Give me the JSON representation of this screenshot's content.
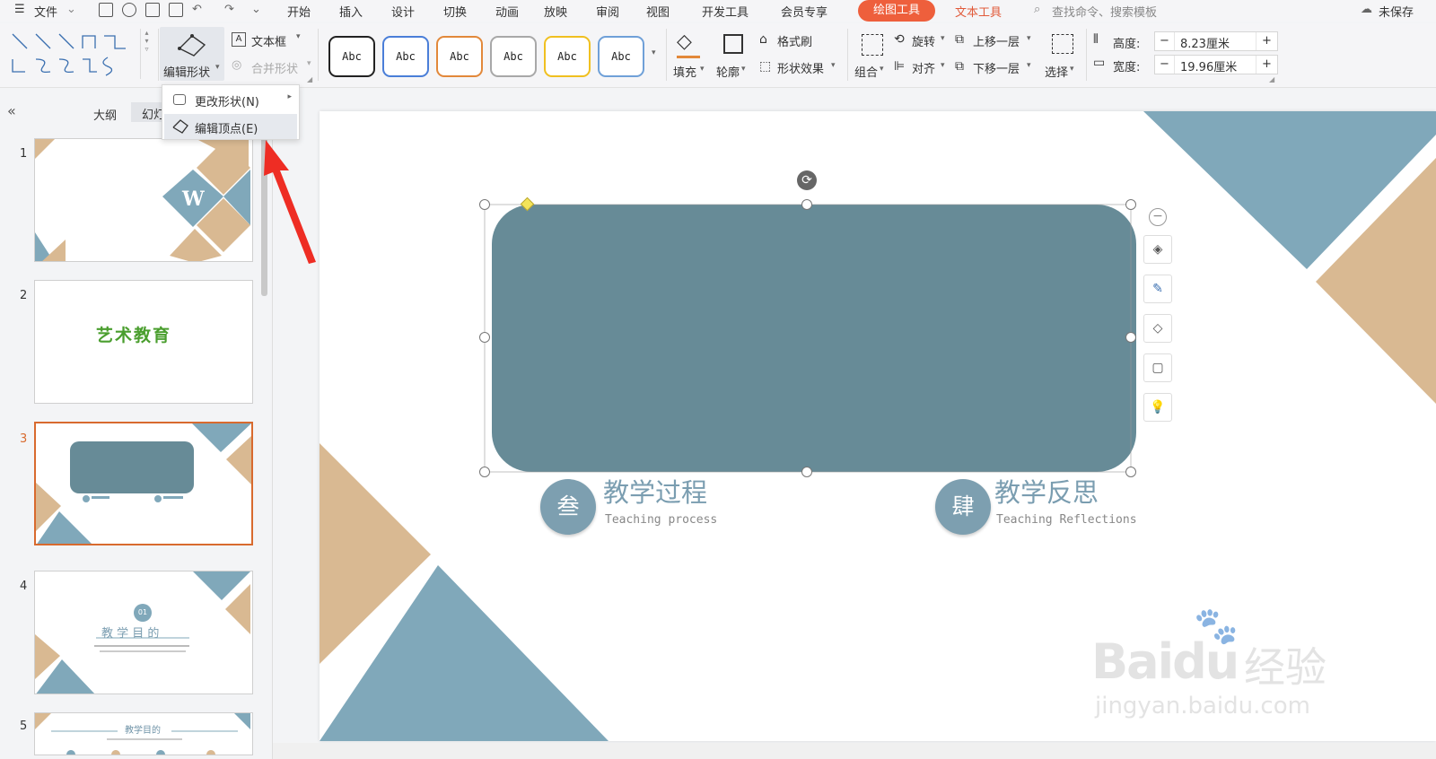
{
  "menubar": {
    "file": "文件",
    "tabs": [
      "开始",
      "插入",
      "设计",
      "切换",
      "动画",
      "放映",
      "审阅",
      "视图",
      "开发工具",
      "会员专享"
    ],
    "draw_tools": "绘图工具",
    "text_tools": "文本工具",
    "search_placeholder": "查找命令、搜索模板",
    "unsaved": "未保存"
  },
  "ribbon": {
    "edit_shape": "编辑形状",
    "text_box": "文本框",
    "merge_shape": "合并形状",
    "style_label": "Abc",
    "fill": "填充",
    "outline": "轮廓",
    "format_painter": "格式刷",
    "shape_effect": "形状效果",
    "group": "组合",
    "rotate": "旋转",
    "align": "对齐",
    "bring_forward": "上移一层",
    "send_backward": "下移一层",
    "select": "选择",
    "height_label": "高度:",
    "height_value": "8.23厘米",
    "width_label": "宽度:",
    "width_value": "19.96厘米"
  },
  "dropdown": {
    "change_shape": "更改形状(N)",
    "edit_points": "编辑顶点(E)"
  },
  "panel": {
    "outline_tab": "大纲",
    "slides_tab": "幻灯"
  },
  "thumbs": [
    {
      "num": "1"
    },
    {
      "num": "2",
      "title": "艺术教育"
    },
    {
      "num": "3"
    },
    {
      "num": "4",
      "circle": "01",
      "title": "教 学 目 的"
    },
    {
      "num": "5",
      "title": "教学目的"
    }
  ],
  "slide": {
    "sec3": {
      "badge": "叁",
      "title": "教学过程",
      "subtitle": "Teaching process"
    },
    "sec4": {
      "badge": "肆",
      "title": "教学反思",
      "subtitle": "Teaching Reflections"
    }
  },
  "colors": {
    "accent": "#ee5f3c",
    "slate": "#678b97",
    "blue": "#80a8ba",
    "tan": "#d9b992",
    "selected_border": "#d86a2e"
  },
  "watermark": {
    "brand": "Baidu",
    "cn": "经验",
    "url": "jingyan.baidu.com"
  }
}
